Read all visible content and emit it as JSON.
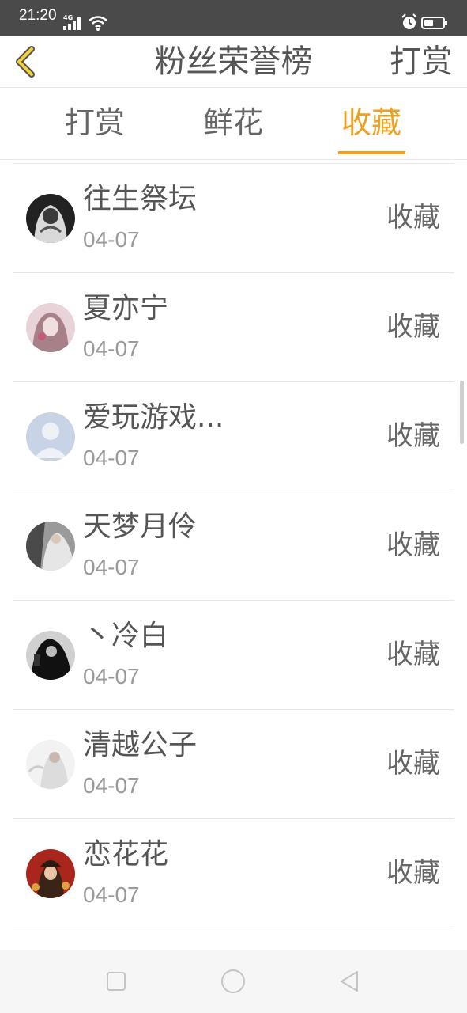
{
  "status_bar": {
    "time": "21:20",
    "network": "4G",
    "icons": [
      "signal-icon",
      "wifi-icon",
      "alarm-icon",
      "battery-icon"
    ]
  },
  "header": {
    "title": "粉丝荣誉榜",
    "action_label": "打赏",
    "back_icon": "chevron-left-icon"
  },
  "tabs": [
    {
      "label": "打赏",
      "active": false
    },
    {
      "label": "鲜花",
      "active": false
    },
    {
      "label": "收藏",
      "active": true
    }
  ],
  "rows": [
    {
      "name": "往生祭坛",
      "date": "04-07",
      "action": "收藏"
    },
    {
      "name": "夏亦宁",
      "date": "04-07",
      "action": "收藏"
    },
    {
      "name": "爱玩游戏...",
      "date": "04-07",
      "action": "收藏"
    },
    {
      "name": "天梦月伶",
      "date": "04-07",
      "action": "收藏"
    },
    {
      "name": "丶冷白",
      "date": "04-07",
      "action": "收藏"
    },
    {
      "name": "清越公子",
      "date": "04-07",
      "action": "收藏"
    },
    {
      "name": "恋花花",
      "date": "04-07",
      "action": "收藏"
    }
  ],
  "colors": {
    "accent": "#f0a020",
    "status_bar": "#4a4a4a",
    "text_primary": "#555555",
    "text_secondary": "#9a9a9a"
  },
  "nav_bar": {
    "icons": [
      "recent-apps-icon",
      "home-icon",
      "back-icon"
    ]
  }
}
